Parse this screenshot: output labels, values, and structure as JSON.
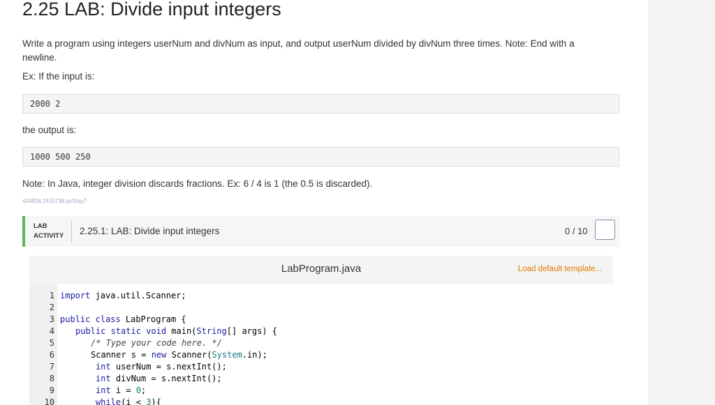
{
  "page": {
    "title": "2.25 LAB: Divide input integers",
    "prompt": "Write a program using integers userNum and divNum as input, and output userNum divided by divNum three times. Note: End with a newline.",
    "example_label": "Ex: If the input is:",
    "example_input": "2000 2",
    "output_label": "the output is:",
    "example_output": "1000 500 250",
    "note": "Note: In Java, integer division discards fractions. Ex: 6 / 4 is 1 (the 0.5 is discarded).",
    "tracking_id": "424834.2615738.qx3zqy7"
  },
  "lab": {
    "tag_line1": "LAB",
    "tag_line2": "ACTIVITY",
    "title": "2.25.1: LAB: Divide input integers",
    "score": "0 / 10",
    "accent": "#5cb85c"
  },
  "editor": {
    "file_name": "LabProgram.java",
    "load_template": "Load default template...",
    "lines": [
      {
        "n": "1"
      },
      {
        "n": "2"
      },
      {
        "n": "3"
      },
      {
        "n": "4"
      },
      {
        "n": "5"
      },
      {
        "n": "6"
      },
      {
        "n": "7"
      },
      {
        "n": "8"
      },
      {
        "n": "9"
      },
      {
        "n": "10"
      }
    ],
    "code": {
      "l1_kw": "import",
      "l1_rest": " java.util.Scanner;",
      "l3_kw": "public class",
      "l3_rest": " LabProgram {",
      "l4_kw": "public static void",
      "l4_mid": " main(",
      "l4_type": "String",
      "l4_rest": "[] args) {",
      "l5_cmt": "/* Type your code here. */",
      "l6_a": "Scanner s = ",
      "l6_kw": "new",
      "l6_b": " Scanner(",
      "l6_cls": "System",
      "l6_c": ".in);",
      "l7_kw": "int",
      "l7_rest": " userNum = s.nextInt();",
      "l8_kw": "int",
      "l8_rest": " divNum = s.nextInt();",
      "l9_kw": "int",
      "l9_rest": " i = ",
      "l9_num": "0",
      "l9_end": ";",
      "l10_kw": "while",
      "l10_rest": "(i < ",
      "l10_num": "3",
      "l10_end": "){"
    }
  }
}
